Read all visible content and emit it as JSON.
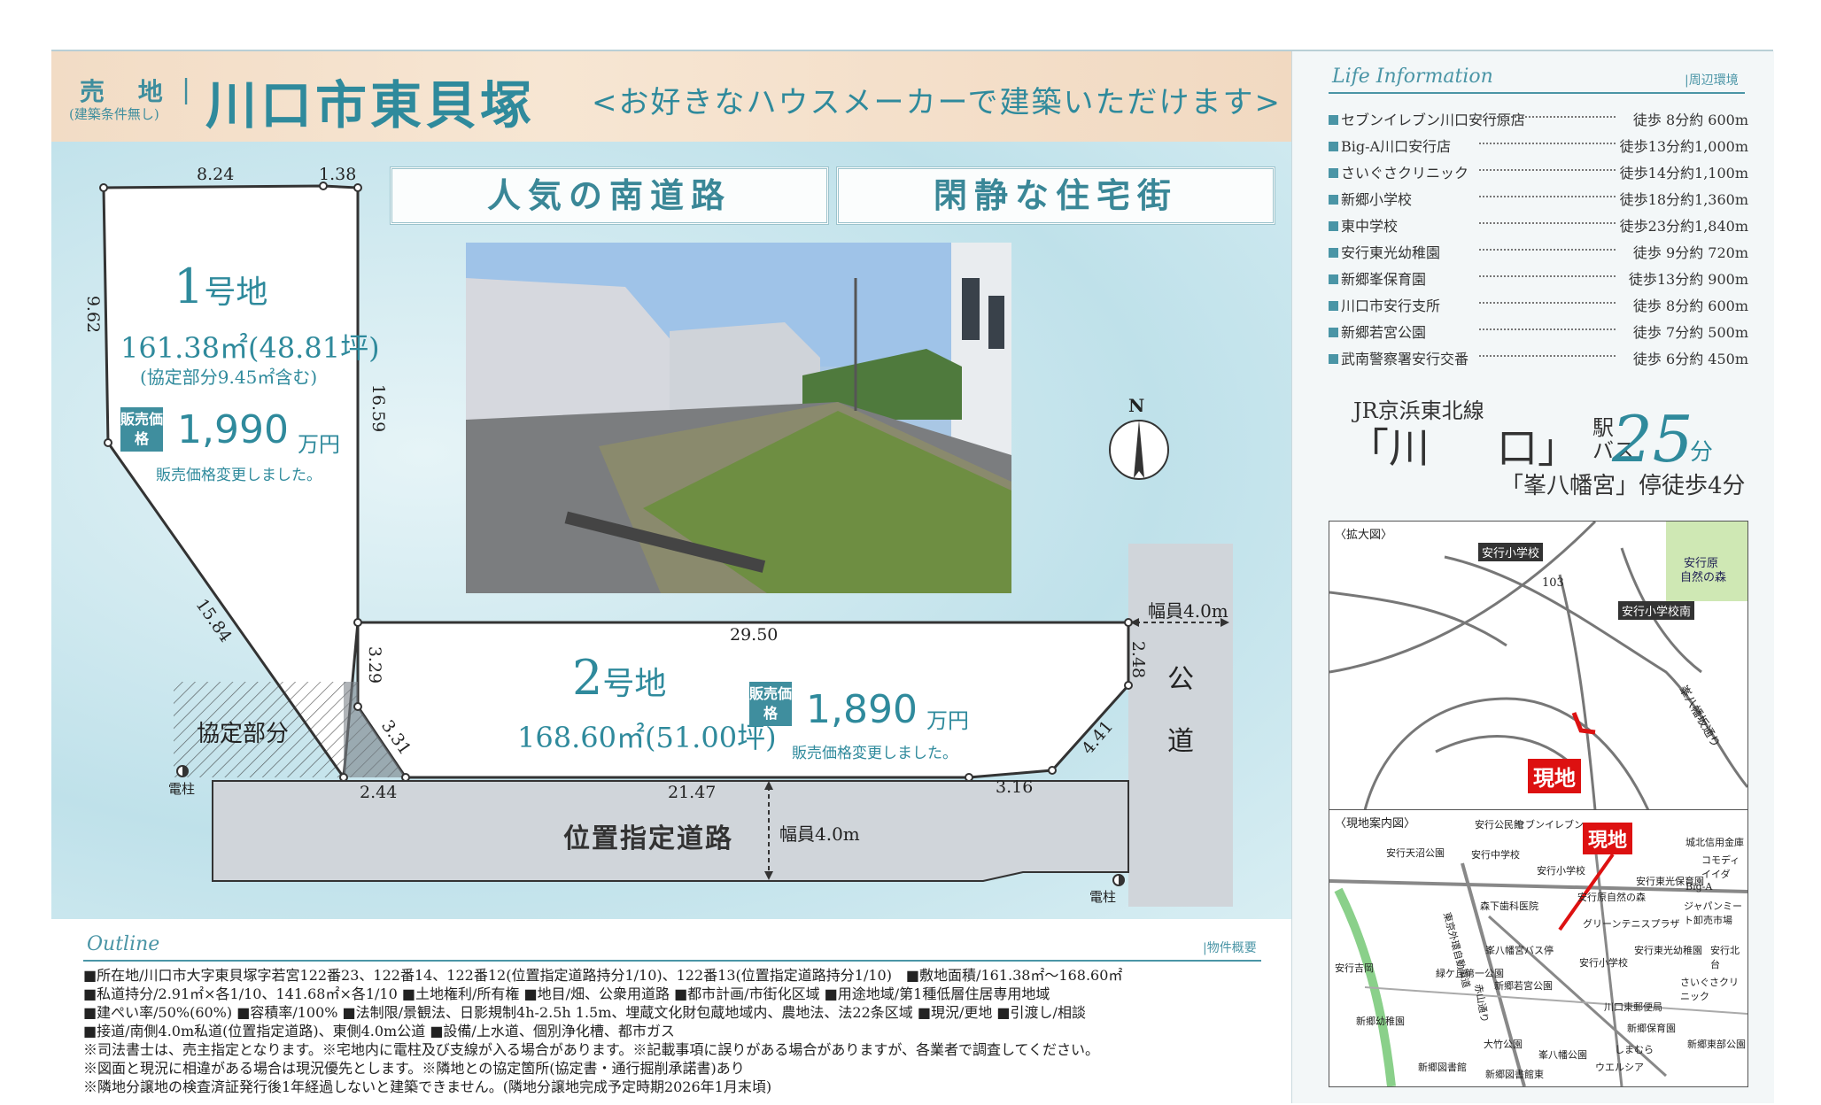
{
  "header": {
    "sale_label": "売 地",
    "sale_sub": "(建築条件無し)",
    "separator": "|",
    "title": "川口市東貝塚",
    "subtitle": "<お好きなハウスメーカーで建築いただけます>"
  },
  "tags": [
    "人気の南道路",
    "閑静な住宅街"
  ],
  "lots": {
    "lot1": {
      "number": "1",
      "number_suffix": "号地",
      "area": "161.38㎡(48.81坪)",
      "area_note": "(協定部分9.45㎡含む)",
      "price_badge": "販売価格",
      "price": "1,990",
      "price_unit": "万円",
      "price_note": "販売価格変更しました。"
    },
    "lot2": {
      "number": "2",
      "number_suffix": "号地",
      "area": "168.60㎡(51.00坪)",
      "price_badge": "販売価格",
      "price": "1,890",
      "price_unit": "万円",
      "price_note": "販売価格変更しました。"
    }
  },
  "dimensions": {
    "top_left": "8.24",
    "top_right": "1.38",
    "left": "9.62",
    "right_lot1": "16.59",
    "diagonal": "15.84",
    "lot2_top": "29.50",
    "lot2_left": "3.29",
    "lot2_chamfer": "3.31",
    "lot2_right": "2.48",
    "lot2_right_diag": "4.41",
    "bottom_right": "3.16",
    "bottom_main": "21.47",
    "bottom_left": "2.44",
    "east_road_width": "幅員4.0m",
    "south_road_width": "幅員4.0m"
  },
  "labels": {
    "agreement_part": "協定部分",
    "pole_left": "電柱",
    "pole_right": "電柱",
    "public_road_1": "公",
    "public_road_2": "道",
    "designated_road": "位置指定道路",
    "north": "N"
  },
  "life_info": {
    "title": "Life Information",
    "area_label": "|周辺環境",
    "items": [
      {
        "name": "セブンイレブン川口安行原店",
        "walk": "徒歩 8分約 600m"
      },
      {
        "name": "Big-A川口安行店",
        "walk": "徒歩13分約1,000m"
      },
      {
        "name": "さいぐさクリニック",
        "walk": "徒歩14分約1,100m"
      },
      {
        "name": "新郷小学校",
        "walk": "徒歩18分約1,360m"
      },
      {
        "name": "東中学校",
        "walk": "徒歩23分約1,840m"
      },
      {
        "name": "安行東光幼稚園",
        "walk": "徒歩 9分約 720m"
      },
      {
        "name": "新郷峯保育園",
        "walk": "徒歩13分約 900m"
      },
      {
        "name": "川口市安行支所",
        "walk": "徒歩 8分約 600m"
      },
      {
        "name": "新郷若宮公園",
        "walk": "徒歩 7分約 500m"
      },
      {
        "name": "武南警察署安行交番",
        "walk": "徒歩 6分約 450m"
      }
    ]
  },
  "access": {
    "line": "JR京浜東北線",
    "station_a": "「川",
    "station_b": "口」",
    "bus_1": "駅",
    "bus_2": "バス",
    "minutes": "25",
    "min_unit": "分",
    "stop": "「峯八幡宮」停徒歩4分"
  },
  "map_zoom": {
    "label": "〈拡大図〉",
    "school": "安行小学校",
    "school_south": "安行小学校南",
    "forest_1": "安行原",
    "forest_2": "自然の森",
    "route": "峯八幡坂通り",
    "route_num": "103",
    "site": "現地"
  },
  "map_area": {
    "label": "〈現地案内図〉",
    "site": "現地",
    "places": [
      "安行天沼公園",
      "安行公民館",
      "安行中学校",
      "セブンイレブン",
      "城北信用金庫",
      "コモディイイダ",
      "安行小学校",
      "安行東光保育園",
      "Big-A",
      "安行原自然の森",
      "ジャパンミート卸売市場",
      "安行吉岡",
      "森下歯科医院",
      "グリーンテニスプラザ",
      "東京外環自動車道",
      "安行東光幼稚園",
      "安行北台",
      "緑ケ丘第一公園",
      "峯八幡宮バス停",
      "安行小学校",
      "新郷若宮公園",
      "さいぐさクリニック",
      "川口東郵便局",
      "新郷幼稚園",
      "大竹公園",
      "新郷東部公園",
      "新郷図書館",
      "新郷図書館東",
      "峯八幡公園",
      "しまむら",
      "ウエルシア",
      "新郷保育園",
      "赤山通り"
    ]
  },
  "outline": {
    "title": "Outline",
    "area_label": "|物件概要",
    "rows": [
      "■所在地/川口市大字東貝塚字若宮122番23、122番14、122番12(位置指定道路持分1/10)、122番13(位置指定道路持分1/10)　■敷地面積/161.38㎡〜168.60㎡",
      "■私道持分/2.91㎡×各1/10、141.68㎡×各1/10 ■土地権利/所有権 ■地目/畑、公衆用道路 ■都市計画/市街化区域 ■用途地域/第1種低層住居専用地域",
      "■建ぺい率/50%(60%) ■容積率/100% ■法制限/景観法、日影規制4h-2.5h 1.5m、埋蔵文化財包蔵地域内、農地法、法22条区域 ■現況/更地 ■引渡し/相談",
      "■接道/南側4.0m私道(位置指定道路)、東側4.0m公道 ■設備/上水道、個別浄化槽、都市ガス",
      "※司法書士は、売主指定となります。※宅地内に電柱及び支線が入る場合があります。※記載事項に誤りがある場合がありますが、各業者で調査してください。",
      "※図面と現況に相違がある場合は現況優先とします。※隣地との協定箇所(協定書・通行掘削承諾書)あり",
      "※隣地分譲地の検査済証発行後1年経過しないと建築できません。(隣地分譲地完成予定時期2026年1月末頃)"
    ]
  }
}
